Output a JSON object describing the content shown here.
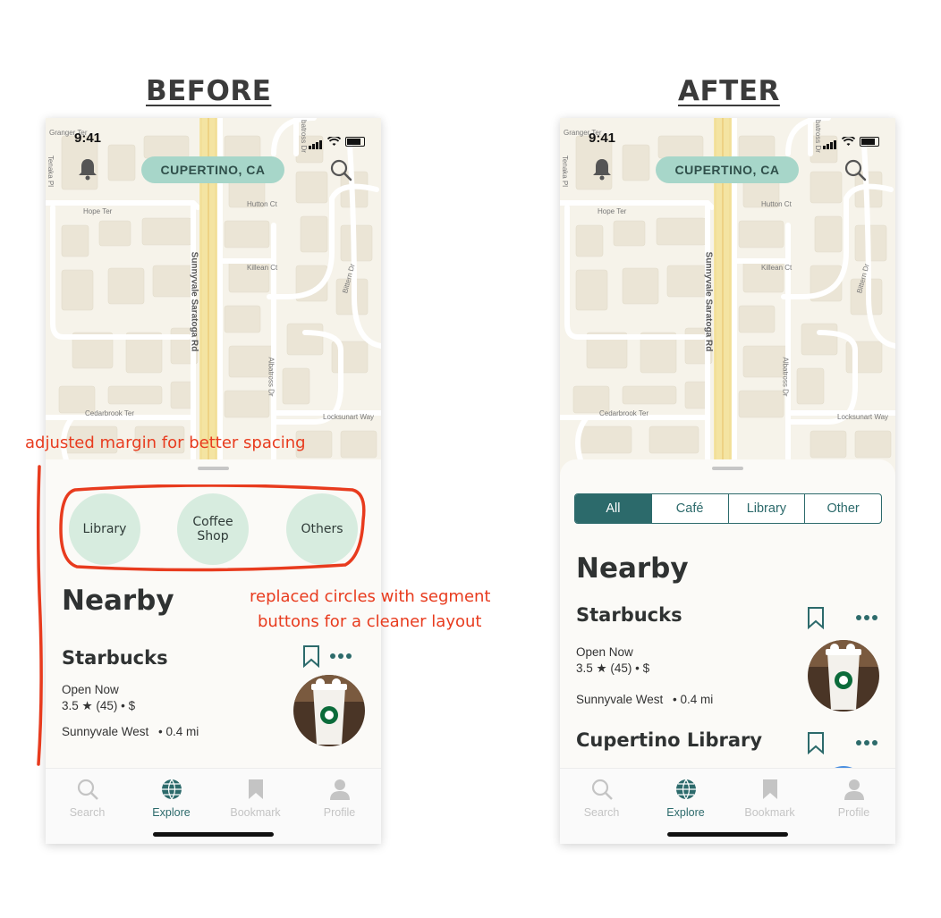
{
  "headings": {
    "before": "BEFORE",
    "after": "AFTER"
  },
  "status": {
    "time": "9:41"
  },
  "location_label": "CUPERTINO, CA",
  "map_labels": {
    "street_main": "Sunnyvale Saratoga Rd",
    "hope": "Hope Ter",
    "hutton": "Hutton Ct",
    "killean": "Killean Ct",
    "bittern": "Bittern Dr",
    "albatross": "Albatross Dr",
    "cedarbrook": "Cedarbrook Ter",
    "locksunart": "Locksunart Way",
    "granger": "Granger Ter",
    "tenaka": "Tenaka Pl",
    "batross": "batross Dr"
  },
  "before": {
    "categories": [
      "Library",
      "Coffee Shop",
      "Others"
    ],
    "section_title": "Nearby",
    "place": {
      "name": "Starbucks",
      "status": "Open Now",
      "rating": "3.5 ★ (45) • $",
      "area": "Sunnyvale West",
      "distance": "• 0.4 mi"
    }
  },
  "after": {
    "segments": [
      "All",
      "Café",
      "Library",
      "Other"
    ],
    "active_segment": "All",
    "section_title": "Nearby",
    "place": {
      "name": "Starbucks",
      "status": "Open Now",
      "rating": "3.5 ★ (45) • $",
      "area": "Sunnyvale West",
      "distance": "• 0.4 mi"
    },
    "second_place": {
      "name": "Cupertino Library"
    }
  },
  "tabs": {
    "search": "Search",
    "explore": "Explore",
    "bookmark": "Bookmark",
    "profile": "Profile",
    "active": "Explore"
  },
  "annotations": {
    "margin": "adjusted margin for better spacing",
    "segments_line1": "replaced circles with segment",
    "segments_line2": "buttons for a cleaner layout"
  },
  "colors": {
    "accent": "#2c6a6b",
    "location_chip": "#a7d6c9",
    "category_circle": "#d7ecdf",
    "annotation": "#e83b1e",
    "map_background": "#f6f3ea"
  },
  "icons": [
    "bell-icon",
    "search-icon",
    "bookmark-icon",
    "more-icon",
    "globe-icon",
    "user-icon",
    "signal-icon",
    "wifi-icon",
    "battery-icon"
  ]
}
